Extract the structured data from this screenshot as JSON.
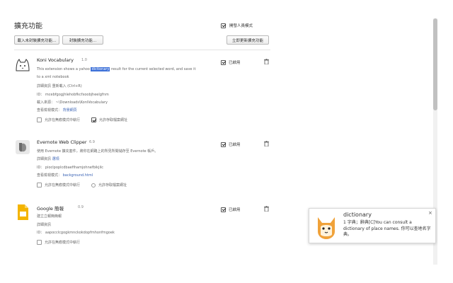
{
  "page": {
    "title": "擴充功能"
  },
  "dev_mode": {
    "label": "開發人員模式",
    "checked": true
  },
  "toolbar": {
    "load_unpacked": "載入未封裝擴充功能…",
    "pack": "封裝擴充功能…",
    "update_now": "立即更新擴充功能"
  },
  "extensions": [
    {
      "name": "Koni Vocabulary",
      "version": "1.0",
      "desc_pre": "This extension shows a yahoo ",
      "desc_hl": "dictionary",
      "desc_post": " result for the current selected word, and save it",
      "desc_line2": "to a xml notebook",
      "links": "詳細資訊    重新載入 (Ctrl+R)",
      "id_label": "ID：",
      "id": "mcebfgogjhlehobfkcfxoobjheelgfnm",
      "src_label": "載入來源：",
      "src": "~\\Downloads\\KoniVocabulary",
      "views_label": "查看檢視模式：",
      "views": "背景網頁",
      "opt1": "允許在無痕模式中執行",
      "opt2": "允許存取檔案網址",
      "enabled_label": "已啟用"
    },
    {
      "name": "Evernote Web Clipper",
      "version": "6.9",
      "desc": "使用 Evernote 擴充套件，將你在網路上的所見所聞儲存至 Evernote 帳戶。",
      "info": "詳細資訊",
      "options": "選項",
      "id_label": "ID：",
      "id": "pioclpoplcdbaefihamjohnefbikjilc",
      "views_label": "查看檢視模式：",
      "views": "background.html",
      "opt1": "允許在無痕模式中執行",
      "opt2": "允許存取檔案網址",
      "enabled_label": "已啟用"
    },
    {
      "name": "Google 簡報",
      "version": "0.9",
      "desc": "建立立報簡簡報",
      "info": "詳細資訊",
      "id_label": "ID：",
      "id": "aapocclcgogkmnckokdopfmhonfmgoek",
      "opt1": "允許在無痕模式中執行",
      "enabled_label": "已啟用"
    }
  ],
  "popup": {
    "word": "dictionary",
    "definition": "1 字典；辭典[C]You can consult a dictionary of place names. 你可以查地名字典。",
    "close": "×"
  }
}
